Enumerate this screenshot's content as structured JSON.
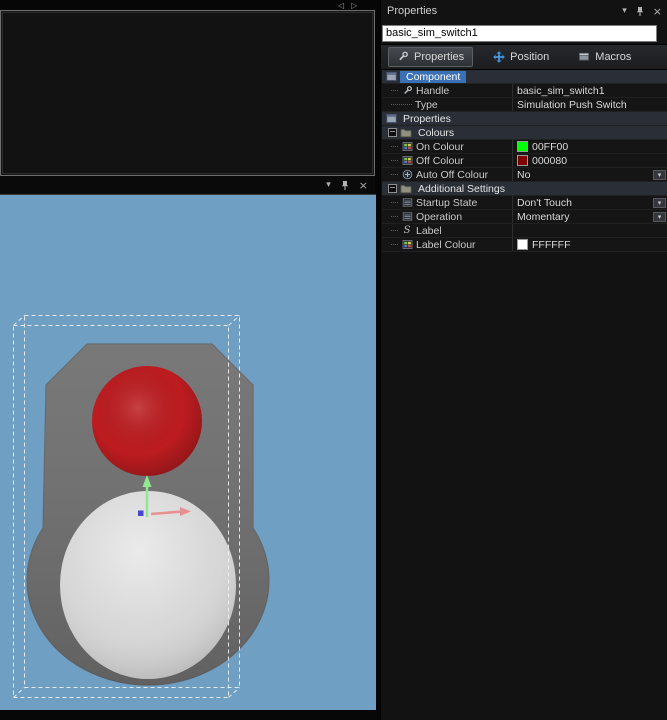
{
  "window": {
    "nav_back_glyph": "◁",
    "nav_forward_glyph": "▷"
  },
  "viewport_toolbar": {
    "menu_glyph": "▾",
    "close_glyph": "×"
  },
  "panel": {
    "title": "Properties",
    "header": {
      "menu_glyph": "▾",
      "close_glyph": "×"
    },
    "name_field": "basic_sim_switch1",
    "tabs": [
      {
        "label": "Properties",
        "selected": true
      },
      {
        "label": "Position",
        "selected": false
      },
      {
        "label": "Macros",
        "selected": false
      }
    ]
  },
  "grid": {
    "rows": [
      {
        "kind": "section",
        "label": "Component"
      },
      {
        "kind": "prop",
        "label": "Handle",
        "value": "basic_sim_switch1"
      },
      {
        "kind": "prop",
        "label": "Type",
        "value": "Simulation Push Switch"
      },
      {
        "kind": "section",
        "label": "Properties"
      },
      {
        "kind": "folder",
        "label": "Colours",
        "expander": "−"
      },
      {
        "kind": "prop",
        "label": "On Colour",
        "value": "00FF00",
        "swatch_style": "background:#00ff00"
      },
      {
        "kind": "prop",
        "label": "Off Colour",
        "value": "000080",
        "swatch_style": "background:#800000"
      },
      {
        "kind": "prop",
        "label": "Auto Off Colour",
        "value": "No",
        "dropdown": "▾"
      },
      {
        "kind": "folder",
        "label": "Additional Settings",
        "expander": "−"
      },
      {
        "kind": "prop",
        "label": "Startup State",
        "value": "Don't Touch",
        "dropdown": "▾"
      },
      {
        "kind": "prop",
        "label": "Operation",
        "value": "Momentary",
        "dropdown": "▾"
      },
      {
        "kind": "prop",
        "label": "Label",
        "value": ""
      },
      {
        "kind": "prop",
        "label": "Label Colour",
        "value": "FFFFFF",
        "swatch_style": "background:#ffffff"
      }
    ]
  },
  "scene": {
    "colors": {
      "viewport_bg": "#6f9fc2",
      "body_gray": "#6e6e6e",
      "button_red": "#bd1c20",
      "dome_gray": "#d6d6d6",
      "axis_y_green": "#90e890",
      "axis_x_red": "#e89090",
      "axis_z_blue": "#4646d0",
      "selection_highlight": "#3a70b5"
    }
  }
}
